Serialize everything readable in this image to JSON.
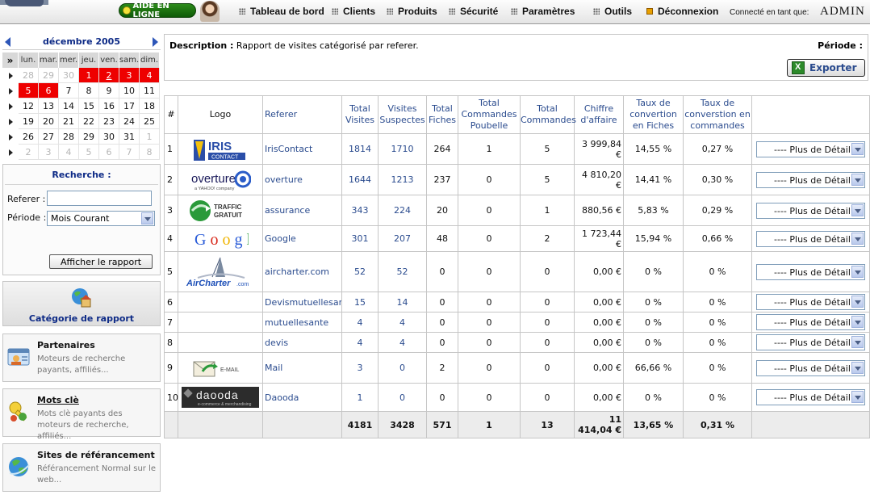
{
  "topbar": {
    "help_label": "AIDE EN LIGNE",
    "nav": [
      "Tableau de bord",
      "Clients",
      "Produits",
      "Sécurité",
      "Paramètres",
      "Outils",
      "Déconnexion"
    ],
    "connected_label": "Connecté en tant que:",
    "user": "ADMIN"
  },
  "calendar": {
    "month": "décembre 2005",
    "corner": "»",
    "days_of_week": [
      "lun.",
      "mar.",
      "mer.",
      "jeu.",
      "ven.",
      "sam.",
      "dim."
    ],
    "weeks": [
      [
        "28",
        "29",
        "30",
        "1",
        "2",
        "3",
        "4"
      ],
      [
        "5",
        "6",
        "7",
        "8",
        "9",
        "10",
        "11"
      ],
      [
        "12",
        "13",
        "14",
        "15",
        "16",
        "17",
        "18"
      ],
      [
        "19",
        "20",
        "21",
        "22",
        "23",
        "24",
        "25"
      ],
      [
        "26",
        "27",
        "28",
        "29",
        "30",
        "31",
        "1"
      ],
      [
        "2",
        "3",
        "4",
        "5",
        "6",
        "7",
        "8"
      ]
    ],
    "highlight_color": "#ee0000"
  },
  "search": {
    "title": "Recherche :",
    "referer_label": "Referer :",
    "referer_value": "",
    "period_label": "Période :",
    "period_value": "Mois Courant",
    "submit_label": "Afficher le rapport"
  },
  "category": {
    "label": "Catégorie de rapport"
  },
  "partners": {
    "title": "Partenaires",
    "desc": "Moteurs de recherche payants, affiliés..."
  },
  "keywords": {
    "title": "Mots clè",
    "desc": "Mots clè payants des moteurs de recherche, affiliés..."
  },
  "sites": {
    "title": "Sites de référancement",
    "desc": "Référancement Normal sur le web..."
  },
  "main": {
    "desc_label": "Description :",
    "desc_text": "Rapport de visites catégorisé par referer.",
    "period_label": "Période :",
    "export_label": "Exporter"
  },
  "table": {
    "headers": [
      "#",
      "Logo",
      "Referer",
      "Total Visites",
      "Visites Suspectes",
      "Total Fiches",
      "Total Commandes Poubelle",
      "Total Commandes",
      "Chiffre d'affaire",
      "Taux de convertion en Fiches",
      "Taux de converstion en commandes"
    ],
    "detail_label": "---- Plus de Détail ---",
    "rows": [
      {
        "n": "1",
        "logo": "IrisContact",
        "referer": "IrisContact",
        "visites": "1814",
        "suspectes": "1710",
        "fiches": "264",
        "poubelle": "1",
        "commandes": "5",
        "ca": "3 999,84 €",
        "taux_fiches": "14,55 %",
        "taux_cmd": "0,27 %"
      },
      {
        "n": "2",
        "logo": "Overture",
        "referer": "overture",
        "visites": "1644",
        "suspectes": "1213",
        "fiches": "237",
        "poubelle": "0",
        "commandes": "5",
        "ca": "4 810,20 €",
        "taux_fiches": "14,41 %",
        "taux_cmd": "0,30 %"
      },
      {
        "n": "3",
        "logo": "Traffic Gratuit",
        "referer": "assurance",
        "visites": "343",
        "suspectes": "224",
        "fiches": "20",
        "poubelle": "0",
        "commandes": "1",
        "ca": "880,56 €",
        "taux_fiches": "5,83 %",
        "taux_cmd": "0,29 %"
      },
      {
        "n": "4",
        "logo": "Google",
        "referer": "Google",
        "visites": "301",
        "suspectes": "207",
        "fiches": "48",
        "poubelle": "0",
        "commandes": "2",
        "ca": "1 723,44 €",
        "taux_fiches": "15,94 %",
        "taux_cmd": "0,66 %"
      },
      {
        "n": "5",
        "logo": "AirCharter.com",
        "referer": "aircharter.com",
        "visites": "52",
        "suspectes": "52",
        "fiches": "0",
        "poubelle": "0",
        "commandes": "0",
        "ca": "0,00 €",
        "taux_fiches": "0 %",
        "taux_cmd": "0 %"
      },
      {
        "n": "6",
        "logo": "",
        "referer": "Devismutuellesante",
        "visites": "15",
        "suspectes": "14",
        "fiches": "0",
        "poubelle": "0",
        "commandes": "0",
        "ca": "0,00 €",
        "taux_fiches": "0 %",
        "taux_cmd": "0 %"
      },
      {
        "n": "7",
        "logo": "",
        "referer": "mutuellesante",
        "visites": "4",
        "suspectes": "4",
        "fiches": "0",
        "poubelle": "0",
        "commandes": "0",
        "ca": "0,00 €",
        "taux_fiches": "0 %",
        "taux_cmd": "0 %"
      },
      {
        "n": "8",
        "logo": "",
        "referer": "devis",
        "visites": "4",
        "suspectes": "4",
        "fiches": "0",
        "poubelle": "0",
        "commandes": "0",
        "ca": "0,00 €",
        "taux_fiches": "0 %",
        "taux_cmd": "0 %"
      },
      {
        "n": "9",
        "logo": "E-MAIL",
        "referer": "Mail",
        "visites": "3",
        "suspectes": "0",
        "fiches": "2",
        "poubelle": "0",
        "commandes": "0",
        "ca": "0,00 €",
        "taux_fiches": "66,66 %",
        "taux_cmd": "0 %"
      },
      {
        "n": "10",
        "logo": "daooda",
        "referer": "Daooda",
        "visites": "1",
        "suspectes": "0",
        "fiches": "0",
        "poubelle": "0",
        "commandes": "0",
        "ca": "0,00 €",
        "taux_fiches": "0 %",
        "taux_cmd": "0 %"
      }
    ],
    "totals": {
      "visites": "4181",
      "suspectes": "3428",
      "fiches": "571",
      "poubelle": "1",
      "commandes": "13",
      "ca": "11 414,04 €",
      "taux_fiches": "13,65 %",
      "taux_cmd": "0,31 %"
    }
  },
  "logos": {
    "iris_word": "IRIS",
    "iris_sub": "CONTACT",
    "overture_word": "overture",
    "overture_sub": "a YAHOO! company",
    "traffic_line1": "TRAFFIC",
    "traffic_line2": "GRATUIT",
    "google_letters": [
      "G",
      "o",
      "o",
      "g",
      "l",
      "e"
    ],
    "aircharter_word": "AirCharter",
    "aircharter_suffix": ".com",
    "mail_word": "E-MAIL",
    "daooda_word": "daooda",
    "daooda_sub": "e-commerce & merchandising"
  },
  "colors": {
    "link": "#2a4b8e",
    "title": "#0d2a86",
    "help_green": "#1e7a12"
  }
}
